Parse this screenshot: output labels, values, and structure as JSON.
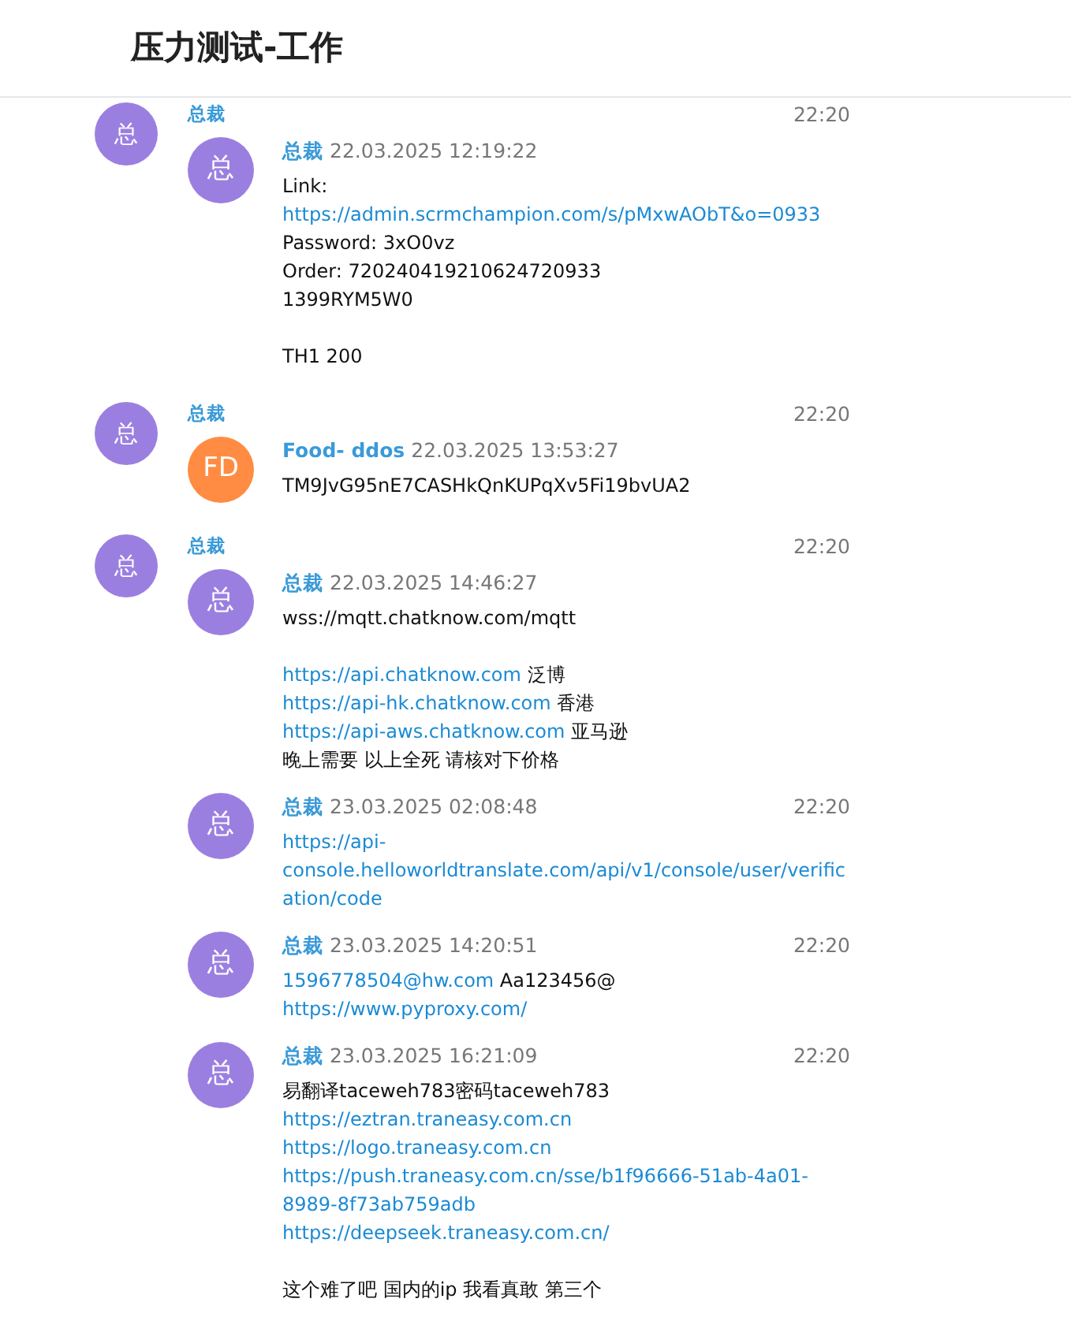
{
  "title": "压力测试-工作",
  "groups": [
    {
      "sender": {
        "initial": "总",
        "name": "总裁",
        "color": "#9b7fe0"
      },
      "time": "22:20",
      "messages": [
        {
          "avatar": {
            "initial": "总",
            "color": "#9b7fe0"
          },
          "author": "总裁",
          "date": "22.03.2025 12:19:22",
          "paragraphs": [
            [
              [
                {
                  "kind": "text",
                  "text": "Link:"
                }
              ],
              [
                {
                  "kind": "link",
                  "text": "https://admin.scrmchampion.com/s/pMxwAObT&o=0933"
                }
              ],
              [
                {
                  "kind": "text",
                  "text": "Password: 3xO0vz"
                }
              ],
              [
                {
                  "kind": "text",
                  "text": "Order: 720240419210624720933"
                }
              ],
              [
                {
                  "kind": "text",
                  "text": "1399RYM5W0"
                }
              ]
            ],
            [
              [
                {
                  "kind": "text",
                  "text": "TH1 200"
                }
              ]
            ]
          ]
        }
      ]
    },
    {
      "sender": {
        "initial": "总",
        "name": "总裁",
        "color": "#9b7fe0"
      },
      "time": "22:20",
      "messages": [
        {
          "avatar": {
            "initial": "FD",
            "color": "#ff8c42"
          },
          "author": "Food- ddos",
          "date": "22.03.2025 13:53:27",
          "paragraphs": [
            [
              [
                {
                  "kind": "text",
                  "text": "TM9JvG95nE7CASHkQnKUPqXv5Fi19bvUA2"
                }
              ]
            ]
          ]
        }
      ]
    },
    {
      "sender": {
        "initial": "总",
        "name": "总裁",
        "color": "#9b7fe0"
      },
      "time": "22:20",
      "messages": [
        {
          "avatar": {
            "initial": "总",
            "color": "#9b7fe0"
          },
          "author": "总裁",
          "date": "22.03.2025 14:46:27",
          "paragraphs": [
            [
              [
                {
                  "kind": "text",
                  "text": "wss://mqtt.chatknow.com/mqtt"
                }
              ]
            ],
            [
              [
                {
                  "kind": "link",
                  "text": "https://api.chatknow.com"
                },
                {
                  "kind": "text",
                  "text": " 泛博"
                }
              ],
              [
                {
                  "kind": "link",
                  "text": "https://api-hk.chatknow.com"
                },
                {
                  "kind": "text",
                  "text": " 香港"
                }
              ],
              [
                {
                  "kind": "link",
                  "text": "https://api-aws.chatknow.com"
                },
                {
                  "kind": "text",
                  "text": " 亚马逊"
                }
              ],
              [
                {
                  "kind": "text",
                  "text": "晚上需要 以上全死 请核对下价格"
                }
              ]
            ]
          ]
        },
        {
          "avatar": {
            "initial": "总",
            "color": "#9b7fe0"
          },
          "author": "总裁",
          "date": "23.03.2025 02:08:48",
          "time": "22:20",
          "paragraphs": [
            [
              [
                {
                  "kind": "link",
                  "text": "https://api-console.helloworldtranslate.com/api/v1/console/user/verification/code"
                }
              ]
            ]
          ]
        },
        {
          "avatar": {
            "initial": "总",
            "color": "#9b7fe0"
          },
          "author": "总裁",
          "date": "23.03.2025 14:20:51",
          "time": "22:20",
          "paragraphs": [
            [
              [
                {
                  "kind": "link",
                  "text": "1596778504@hw.com"
                },
                {
                  "kind": "text",
                  "text": " Aa123456@"
                }
              ],
              [
                {
                  "kind": "link",
                  "text": "https://www.pyproxy.com/"
                }
              ]
            ]
          ]
        },
        {
          "avatar": {
            "initial": "总",
            "color": "#9b7fe0"
          },
          "author": "总裁",
          "date": "23.03.2025 16:21:09",
          "time": "22:20",
          "paragraphs": [
            [
              [
                {
                  "kind": "text",
                  "text": "易翻译taceweh783密码taceweh783"
                }
              ],
              [
                {
                  "kind": "link",
                  "text": "https://eztran.traneasy.com.cn"
                }
              ],
              [
                {
                  "kind": "link",
                  "text": "https://logo.traneasy.com.cn"
                }
              ],
              [
                {
                  "kind": "link",
                  "text": "https://push.traneasy.com.cn/sse/b1f96666-51ab-4a01-8989-8f73ab759adb"
                }
              ],
              [
                {
                  "kind": "link",
                  "text": "https://deepseek.traneasy.com.cn/"
                }
              ]
            ],
            [
              [
                {
                  "kind": "text",
                  "text": "这个难了吧 国内的ip 我看真敢 第三个"
                }
              ]
            ]
          ]
        }
      ]
    }
  ]
}
